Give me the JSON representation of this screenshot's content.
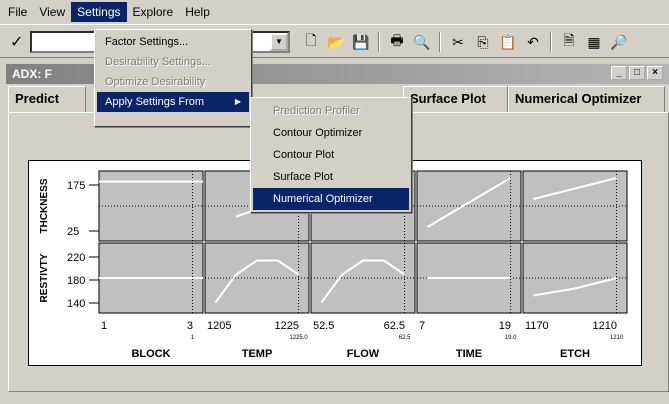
{
  "menubar": {
    "items": [
      {
        "label": "File"
      },
      {
        "label": "View"
      },
      {
        "label": "Settings"
      },
      {
        "label": "Explore"
      },
      {
        "label": "Help"
      }
    ]
  },
  "settings_menu": {
    "items": [
      {
        "label": "Factor Settings...",
        "disabled": false
      },
      {
        "label": "Desirability Settings...",
        "disabled": true
      },
      {
        "label": "Optimize Desirability",
        "disabled": true
      },
      {
        "label": "Apply Settings From",
        "disabled": false,
        "submenu": true
      }
    ]
  },
  "apply_submenu": {
    "items": [
      {
        "label": "Prediction Profiler",
        "disabled": true
      },
      {
        "label": "Contour Optimizer",
        "disabled": false
      },
      {
        "label": "Contour Plot",
        "disabled": false
      },
      {
        "label": "Surface Plot",
        "disabled": false
      },
      {
        "label": "Numerical Optimizer",
        "disabled": false,
        "selected": true
      }
    ]
  },
  "window": {
    "title_visible": "ADX: F",
    "buttons": [
      "_",
      "□",
      "×"
    ]
  },
  "tabs": {
    "visible_first": "Predict",
    "surface_plot": "Surface Plot",
    "numerical_optimizer": "Numerical Optimizer"
  },
  "chart_data": {
    "type": "line",
    "title": "Prediction Profiler",
    "responses": [
      {
        "name": "THCKNESS",
        "y_ticks": [
          "175",
          "25"
        ],
        "current_value": "162"
      },
      {
        "name": "RESTIVTY",
        "y_ticks": [
          "220",
          "180",
          "140"
        ],
        "current_value": "180"
      }
    ],
    "factors": [
      {
        "name": "BLOCK",
        "min": "1",
        "max": "3",
        "current": "1"
      },
      {
        "name": "TEMP",
        "min": "1205",
        "max": "1225",
        "current": "1225.0"
      },
      {
        "name": "FLOW",
        "min": "52.5",
        "max": "62.5",
        "current": "62.5"
      },
      {
        "name": "TIME",
        "min": "7",
        "max": "19",
        "current": "19.0"
      },
      {
        "name": "ETCH",
        "min": "1170",
        "max": "1210",
        "current": "1210"
      }
    ],
    "curves": {
      "THCKNESS": [
        {
          "x": [
            0,
            1
          ],
          "y": [
            0.85,
            0.85
          ]
        },
        {
          "x": [
            0.3,
            0.5
          ],
          "y": [
            0.35,
            0.45
          ]
        },
        {
          "x": [],
          "y": []
        },
        {
          "x": [
            0.1,
            0.9
          ],
          "y": [
            0.2,
            0.9
          ]
        },
        {
          "x": [
            0.1,
            0.9
          ],
          "y": [
            0.6,
            0.9
          ]
        }
      ],
      "RESTIVTY": [
        {
          "x": [
            0,
            1
          ],
          "y": [
            0.5,
            0.5
          ]
        },
        {
          "x": [
            0.1,
            0.3,
            0.5,
            0.7,
            0.9
          ],
          "y": [
            0.15,
            0.55,
            0.75,
            0.75,
            0.55
          ]
        },
        {
          "x": [
            0.1,
            0.3,
            0.5,
            0.7,
            0.9
          ],
          "y": [
            0.15,
            0.55,
            0.75,
            0.75,
            0.55
          ]
        },
        {
          "x": [
            0.1,
            0.9
          ],
          "y": [
            0.5,
            0.5
          ]
        },
        {
          "x": [
            0.1,
            0.5,
            0.9
          ],
          "y": [
            0.25,
            0.35,
            0.5
          ]
        }
      ]
    }
  }
}
